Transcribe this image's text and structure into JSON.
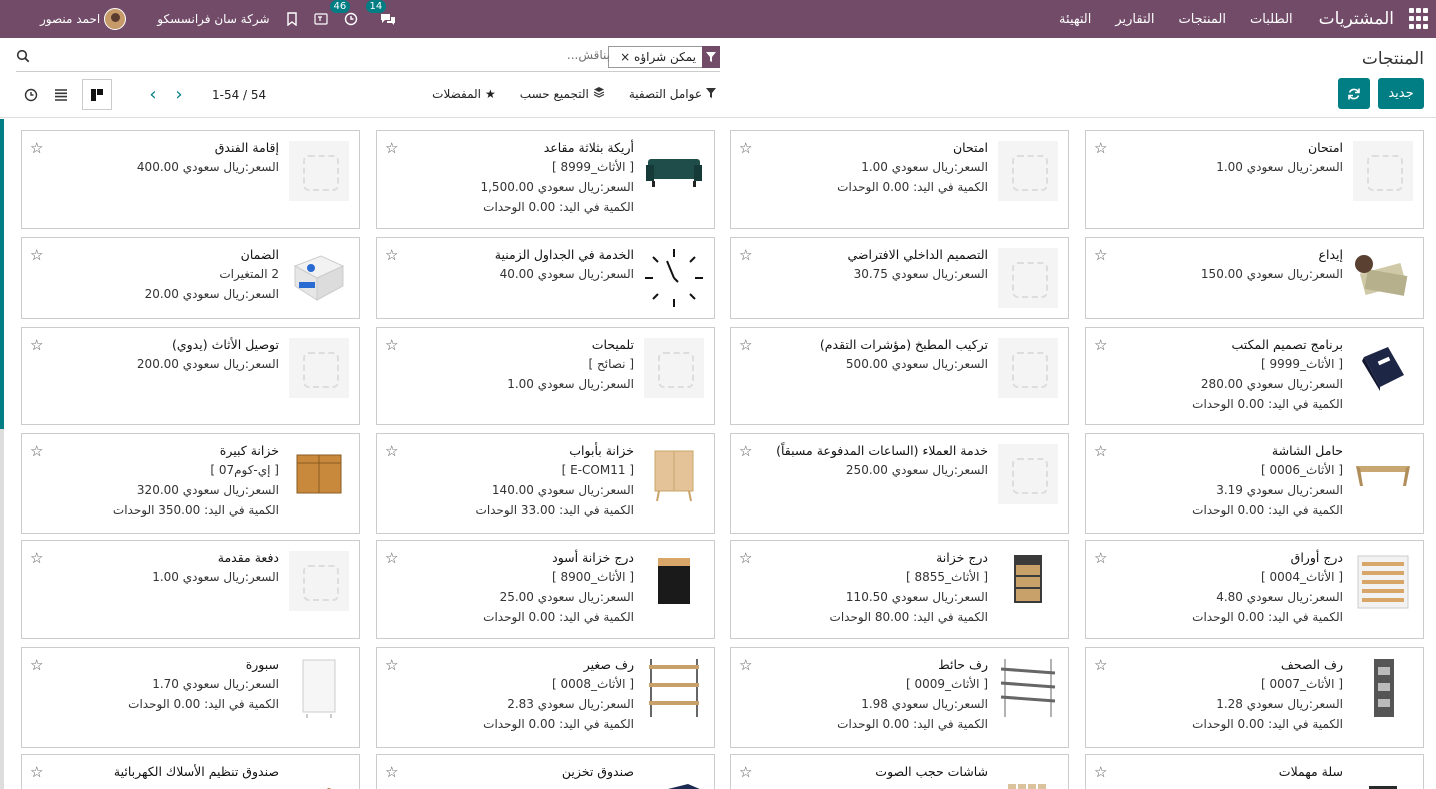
{
  "navbar": {
    "app_name": "المشتريات",
    "menu": [
      "الطلبات",
      "المنتجات",
      "التقارير",
      "التهيئة"
    ],
    "chat_count": "14",
    "activity_count": "46",
    "company": "شركة سان فرانسسكو",
    "user": "احمد منصور",
    "bg_color": "#714B67"
  },
  "control": {
    "breadcrumb": "المنتجات",
    "new_label": "جديد",
    "facet_value": "يمكن شراؤه",
    "search_placeholder": "بناقش...",
    "filters_label": "عوامل التصفية",
    "groupby_label": "التجميع حسب",
    "favorites_label": "المفضلات",
    "pager_value": "1-54 / 54",
    "accent_color": "#017E84"
  },
  "cards": [
    {
      "name": "امتحان",
      "lines": [
        "السعر:ريال سعودي 1.00"
      ],
      "img": "placeholder"
    },
    {
      "name": "امتحان",
      "lines": [
        "السعر:ريال سعودي 1.00",
        "الكمية في اليد: 0.00 الوحدات"
      ],
      "img": "placeholder"
    },
    {
      "name": "أريكة بثلاثة مقاعد",
      "lines": [
        "[ الأثاث_8999 ]",
        "السعر:ريال سعودي 1,500.00",
        "الكمية في اليد: 0.00 الوحدات"
      ],
      "img": "sofa"
    },
    {
      "name": "إقامة الفندق",
      "lines": [
        "السعر:ريال سعودي 400.00"
      ],
      "img": "placeholder"
    },
    {
      "name": "إيداع",
      "lines": [
        "السعر:ريال سعودي 150.00"
      ],
      "img": "money"
    },
    {
      "name": "التصميم الداخلي الافتراضي",
      "lines": [
        "السعر:ريال سعودي 30.75"
      ],
      "img": "placeholder"
    },
    {
      "name": "الخدمة في الجداول الزمنية",
      "lines": [
        "السعر:ريال سعودي 40.00"
      ],
      "img": "clock"
    },
    {
      "name": "الضمان",
      "lines": [
        "2 المتغيرات",
        "السعر:ريال سعودي 20.00"
      ],
      "img": "box"
    },
    {
      "name": "برنامج تصميم المكتب",
      "lines": [
        "[ الأثاث_9999 ]",
        "السعر:ريال سعودي 280.00",
        "الكمية في اليد: 0.00 الوحدات"
      ],
      "img": "software"
    },
    {
      "name": "تركيب المطبخ (مؤشرات التقدم)",
      "lines": [
        "السعر:ريال سعودي 500.00"
      ],
      "img": "placeholder"
    },
    {
      "name": "تلميحات",
      "lines": [
        "[ نصائح ]",
        "السعر:ريال سعودي 1.00"
      ],
      "img": "placeholder"
    },
    {
      "name": "توصيل الأثاث (يدوي)",
      "lines": [
        "السعر:ريال سعودي 200.00"
      ],
      "img": "placeholder"
    },
    {
      "name": "حامل الشاشة",
      "lines": [
        "[ الأثاث_0006 ]",
        "السعر:ريال سعودي 3.19",
        "الكمية في اليد: 0.00 الوحدات"
      ],
      "img": "stand"
    },
    {
      "name": "خدمة العملاء (الساعات المدفوعة مسبقاً)",
      "lines": [
        "السعر:ريال سعودي 250.00"
      ],
      "img": "placeholder"
    },
    {
      "name": "خزانة بأبواب",
      "lines": [
        "[ E-COM11 ]",
        "السعر:ريال سعودي 140.00",
        "الكمية في اليد: 33.00 الوحدات"
      ],
      "img": "cabinet"
    },
    {
      "name": "خزانة كبيرة",
      "lines": [
        "[ إي-كوم07 ]",
        "السعر:ريال سعودي 320.00",
        "الكمية في اليد: 350.00 الوحدات"
      ],
      "img": "bigcabinet"
    },
    {
      "name": "درج أوراق",
      "lines": [
        "[ الأثاث_0004 ]",
        "السعر:ريال سعودي 4.80",
        "الكمية في اليد: 0.00 الوحدات"
      ],
      "img": "tray"
    },
    {
      "name": "درج خزانة",
      "lines": [
        "[ الأثاث_8855 ]",
        "السعر:ريال سعودي 110.50",
        "الكمية في اليد: 80.00 الوحدات"
      ],
      "img": "drawer"
    },
    {
      "name": "درج خزانة أسود",
      "lines": [
        "[ الأثاث_8900 ]",
        "السعر:ريال سعودي 25.00",
        "الكمية في اليد: 0.00 الوحدات"
      ],
      "img": "blackdrawer"
    },
    {
      "name": "دفعة مقدمة",
      "lines": [
        "السعر:ريال سعودي 1.00"
      ],
      "img": "placeholder"
    },
    {
      "name": "رف الصحف",
      "lines": [
        "[ الأثاث_0007 ]",
        "السعر:ريال سعودي 1.28",
        "الكمية في اليد: 0.00 الوحدات"
      ],
      "img": "newsrack"
    },
    {
      "name": "رف حائط",
      "lines": [
        "[ الأثاث_0009 ]",
        "السعر:ريال سعودي 1.98",
        "الكمية في اليد: 0.00 الوحدات"
      ],
      "img": "wallshelf"
    },
    {
      "name": "رف صغير",
      "lines": [
        "[ الأثاث_0008 ]",
        "السعر:ريال سعودي 2.83",
        "الكمية في اليد: 0.00 الوحدات"
      ],
      "img": "shelf"
    },
    {
      "name": "سبورة",
      "lines": [
        "السعر:ريال سعودي 1.70",
        "الكمية في اليد: 0.00 الوحدات"
      ],
      "img": "board"
    },
    {
      "name": "سلة مهملات",
      "lines": [],
      "img": "bin"
    },
    {
      "name": "شاشات حجب الصوت",
      "lines": [],
      "img": "screen"
    },
    {
      "name": "صندوق تخزين",
      "lines": [],
      "img": "storage"
    },
    {
      "name": "صندوق تنظيم الأسلاك الكهربائية",
      "lines": [],
      "img": "cablebox"
    }
  ]
}
